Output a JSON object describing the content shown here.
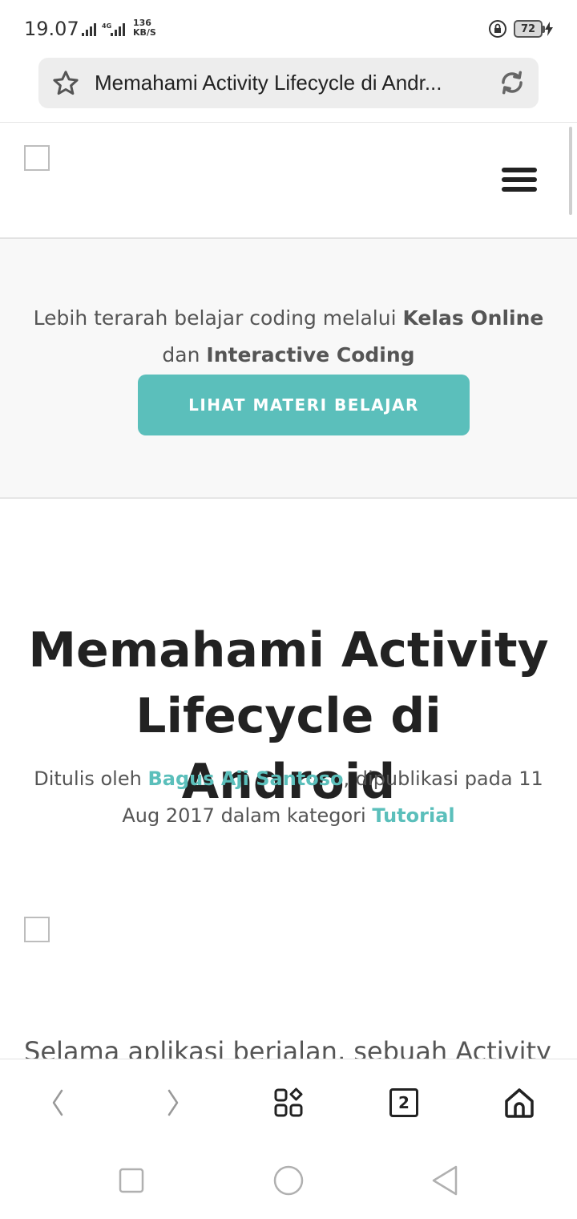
{
  "status_bar": {
    "time": "19.07",
    "network_speed_value": "136",
    "network_speed_unit": "KB/S",
    "network_type": "4G",
    "battery_level": "72"
  },
  "url_bar": {
    "title": "Memahami Activity Lifecycle di Andr..."
  },
  "promo": {
    "text_prefix": "Lebih terarah belajar coding melalui ",
    "highlight_1": "Kelas Online",
    "text_middle": " dan ",
    "highlight_2": "Interactive Coding",
    "button_label": "LIHAT MATERI BELAJAR"
  },
  "article": {
    "title": "Memahami Activity Lifecycle di Android",
    "meta_prefix": "Ditulis oleh ",
    "author": "Bagus Aji Santoso",
    "meta_middle": ", dipublikasi pada 11 Aug 2017 dalam kategori ",
    "category": "Tutorial",
    "body_start": "Selama aplikasi berjalan, sebuah Activity"
  },
  "browser_toolbar": {
    "tab_count": "2"
  },
  "colors": {
    "accent": "#5bbfbb",
    "text": "#555555",
    "heading": "#222222"
  }
}
